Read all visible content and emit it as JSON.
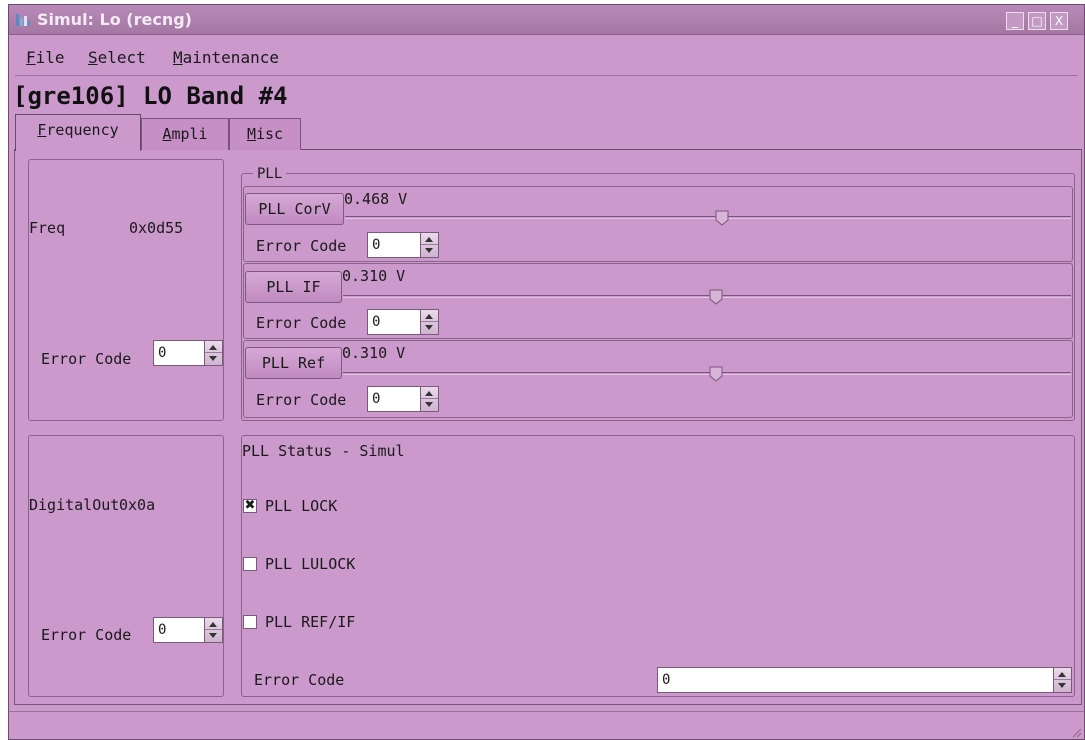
{
  "window": {
    "title": "Simul: Lo (recng)",
    "controls": {
      "minimize": "_",
      "maximize": "□",
      "close": "X"
    }
  },
  "menu": [
    {
      "mnemonic": "F",
      "rest": "ile"
    },
    {
      "mnemonic": "S",
      "rest": "elect"
    },
    {
      "mnemonic": "M",
      "rest": "aintenance"
    }
  ],
  "heading": "[gre106] LO Band #4",
  "tabs": [
    {
      "mnemonic": "F",
      "rest": "requency",
      "active": true
    },
    {
      "mnemonic": "A",
      "rest": "mpli",
      "active": false
    },
    {
      "mnemonic": "M",
      "rest": "isc",
      "active": false
    }
  ],
  "freq_panel": {
    "label": "Freq",
    "value": "0x0d55",
    "error_label": "Error Code",
    "error_value": "0"
  },
  "pll": {
    "legend": "PLL",
    "rows": [
      {
        "button": "PLL CorV",
        "reading": "0.468 V",
        "slider_fraction": 0.58,
        "error_label": "Error Code",
        "error_value": "0"
      },
      {
        "button": "PLL IF",
        "reading": "0.310 V",
        "slider_fraction": 0.57,
        "error_label": "Error Code",
        "error_value": "0"
      },
      {
        "button": "PLL Ref",
        "reading": "0.310 V",
        "slider_fraction": 0.57,
        "error_label": "Error Code",
        "error_value": "0"
      }
    ]
  },
  "digital_panel": {
    "label": "DigitalOut",
    "value": "0x0a",
    "error_label": "Error Code",
    "error_value": "0"
  },
  "pll_status": {
    "title": "PLL Status - Simul",
    "checks": [
      {
        "label": "PLL LOCK",
        "checked": true,
        "mark": "✖"
      },
      {
        "label": "PLL LULOCK",
        "checked": false,
        "mark": ""
      },
      {
        "label": "PLL REF/IF",
        "checked": false,
        "mark": ""
      }
    ],
    "error_label": "Error Code",
    "error_value": "0"
  },
  "colors": {
    "window_bg": "#cc99cc",
    "titlebar": "#a477a4",
    "title_text": "#f4eaf4",
    "border": "#8a628a"
  },
  "icons": {
    "app": "app-icon",
    "minimize": "minimize-icon",
    "maximize": "maximize-icon",
    "close": "close-icon",
    "spin_up": "arrow-up-icon",
    "spin_down": "arrow-down-icon",
    "slider_handle": "slider-handle-icon",
    "check_mark": "x-mark-icon"
  }
}
